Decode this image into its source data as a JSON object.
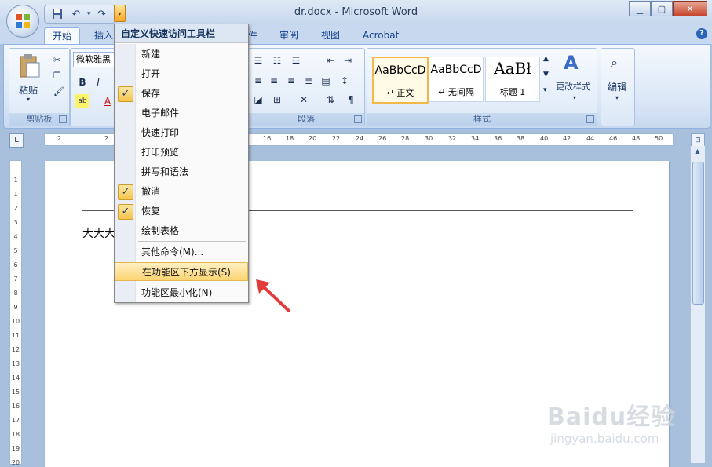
{
  "window": {
    "title": "dr.docx - Microsoft Word"
  },
  "qat": {
    "save_icon": "save-icon",
    "undo_icon": "undo-icon",
    "redo_icon": "redo-icon"
  },
  "tabs": [
    {
      "label": "开始"
    },
    {
      "label": "插入"
    },
    {
      "label": "件"
    },
    {
      "label": "审阅"
    },
    {
      "label": "视图"
    },
    {
      "label": "Acrobat"
    }
  ],
  "ribbon": {
    "clipboard": {
      "paste_label": "粘贴",
      "group_label": "剪贴板"
    },
    "font": {
      "font_name": "微软雅黑"
    },
    "paragraph": {
      "group_label": "段落"
    },
    "styles": {
      "group_label": "样式",
      "items": [
        {
          "sample": "AaBbCcD",
          "name": "↵ 正文"
        },
        {
          "sample": "AaBbCcD",
          "name": "↵ 无间隔"
        },
        {
          "sample": "AaBł",
          "name": "标题 1"
        }
      ],
      "change_styles_label": "更改样式"
    },
    "editing": {
      "label": "编辑"
    }
  },
  "ruler": {
    "h_marks": [
      "2",
      "2",
      "16",
      "18",
      "20",
      "22",
      "24",
      "26",
      "28",
      "30",
      "32",
      "34",
      "36",
      "38",
      "40",
      "42",
      "44",
      "46",
      "48",
      "50"
    ],
    "v_marks": [
      "1",
      "1",
      "2",
      "3",
      "4",
      "5",
      "6",
      "7",
      "8",
      "9",
      "10",
      "11",
      "12",
      "13",
      "14",
      "15",
      "16",
      "17",
      "18",
      "19",
      "20"
    ]
  },
  "document": {
    "body_text": "大大大"
  },
  "menu": {
    "title": "自定义快速访问工具栏",
    "items": [
      {
        "label": "新建",
        "checked": false
      },
      {
        "label": "打开",
        "checked": false
      },
      {
        "label": "保存",
        "checked": true
      },
      {
        "label": "电子邮件",
        "checked": false
      },
      {
        "label": "快速打印",
        "checked": false
      },
      {
        "label": "打印预览",
        "checked": false
      },
      {
        "label": "拼写和语法",
        "checked": false
      },
      {
        "label": "撤消",
        "checked": true
      },
      {
        "label": "恢复",
        "checked": true
      },
      {
        "label": "绘制表格",
        "checked": false
      }
    ],
    "more_commands": "其他命令(M)...",
    "show_below": "在功能区下方显示(S)",
    "minimize_ribbon": "功能区最小化(N)",
    "check_glyph": "✓"
  },
  "watermark": {
    "brand": "Baidu经验",
    "url": "jingyan.baidu.com"
  }
}
